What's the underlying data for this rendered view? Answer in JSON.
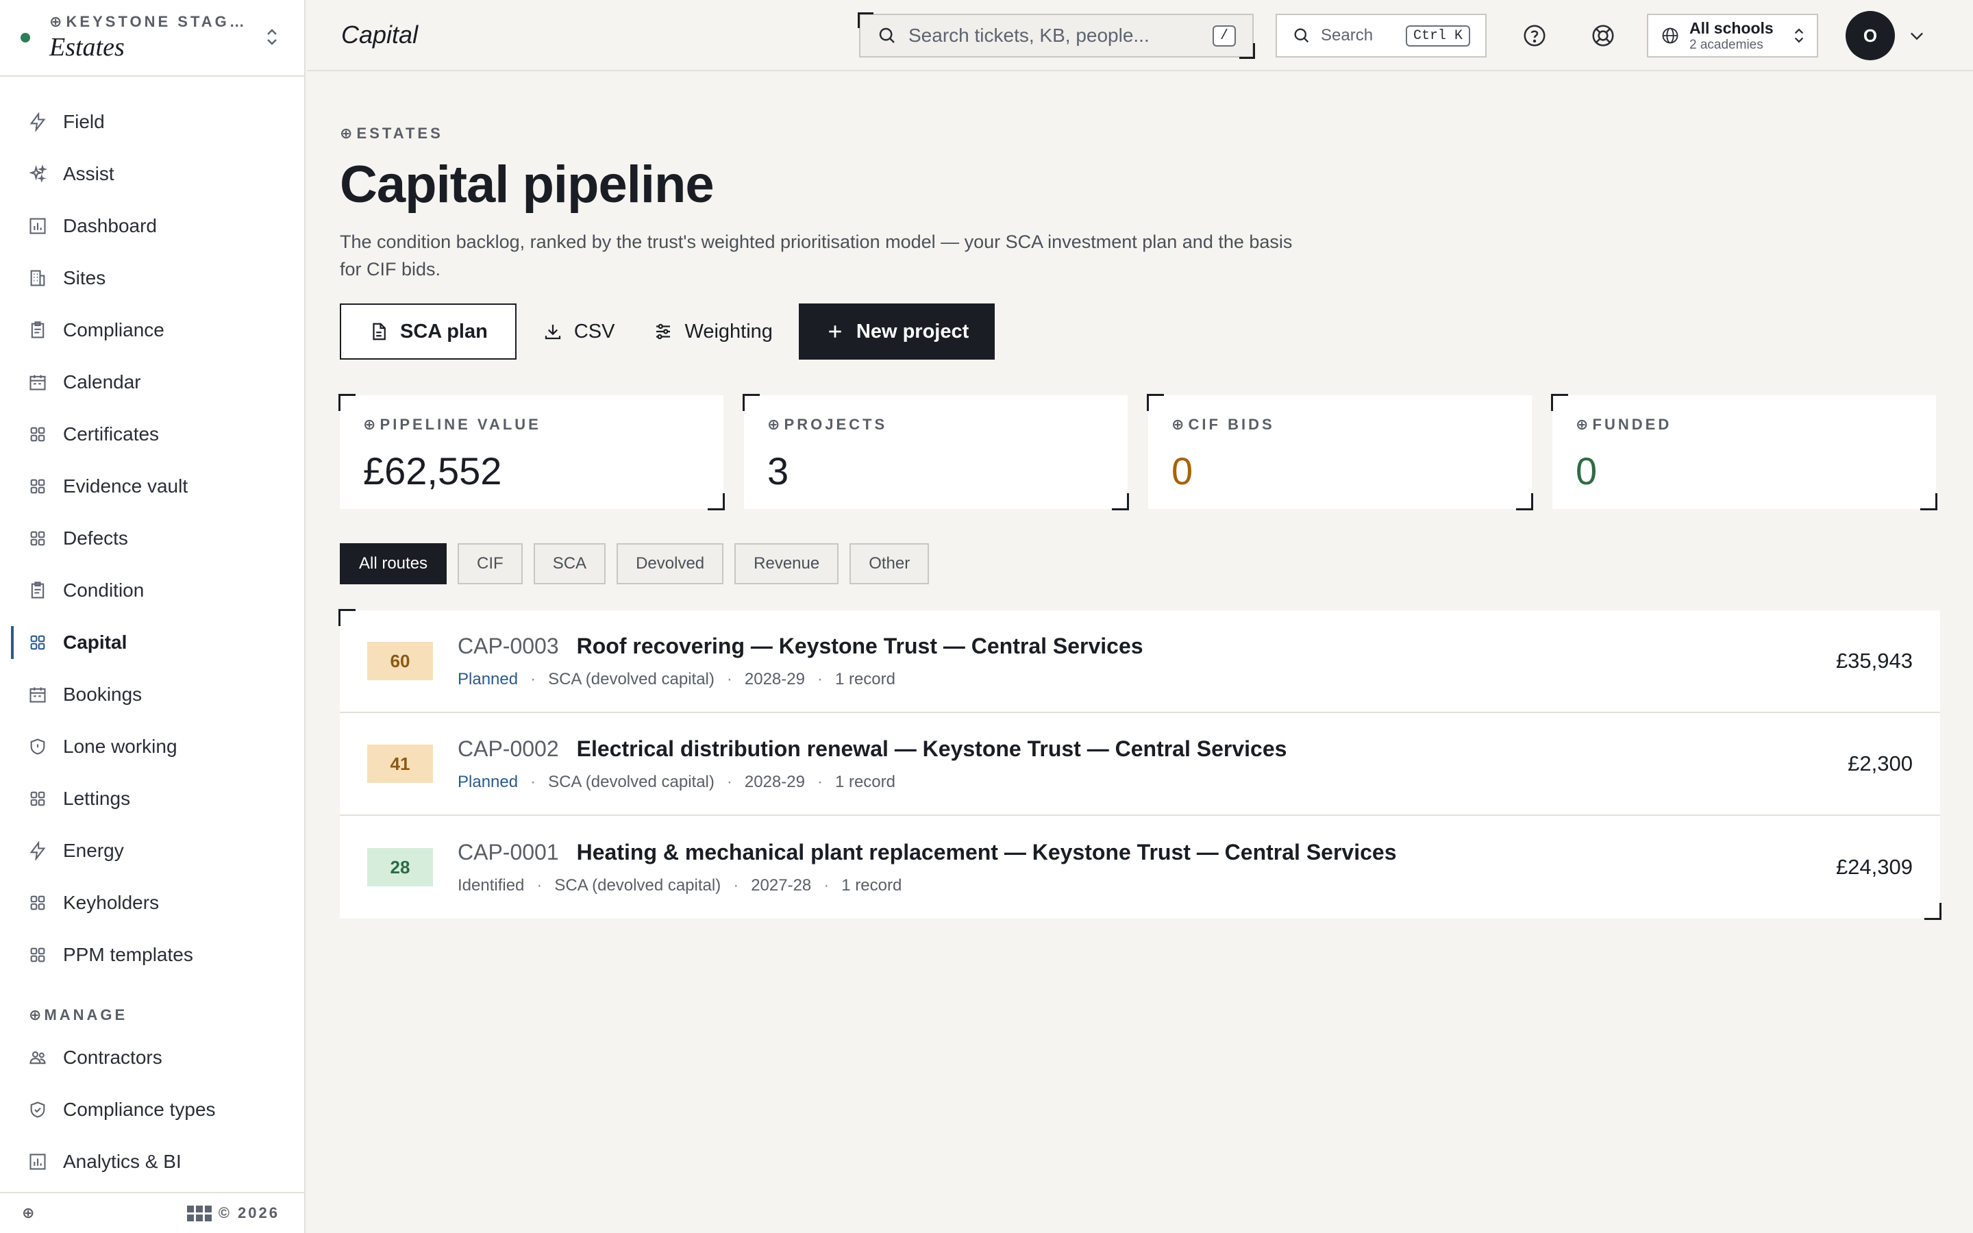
{
  "org": {
    "kicker": "KEYSTONE STAG…",
    "name": "Estates"
  },
  "sidebar": {
    "items": [
      {
        "label": "Field",
        "icon": "bolt-icon"
      },
      {
        "label": "Assist",
        "icon": "sparkle-icon"
      },
      {
        "label": "Dashboard",
        "icon": "chart-icon"
      },
      {
        "label": "Sites",
        "icon": "building-icon"
      },
      {
        "label": "Compliance",
        "icon": "clipboard-icon"
      },
      {
        "label": "Calendar",
        "icon": "calendar-icon"
      },
      {
        "label": "Certificates",
        "icon": "grid-icon"
      },
      {
        "label": "Evidence vault",
        "icon": "grid-icon"
      },
      {
        "label": "Defects",
        "icon": "grid-icon"
      },
      {
        "label": "Condition",
        "icon": "clipboard-icon"
      },
      {
        "label": "Capital",
        "icon": "grid-icon",
        "active": true
      },
      {
        "label": "Bookings",
        "icon": "calendar-icon"
      },
      {
        "label": "Lone working",
        "icon": "shield-icon"
      },
      {
        "label": "Lettings",
        "icon": "grid-icon"
      },
      {
        "label": "Energy",
        "icon": "bolt-icon"
      },
      {
        "label": "Keyholders",
        "icon": "grid-icon"
      },
      {
        "label": "PPM templates",
        "icon": "grid-icon"
      }
    ],
    "manage_label": "MANAGE",
    "manage_items": [
      {
        "label": "Contractors",
        "icon": "people-icon"
      },
      {
        "label": "Compliance types",
        "icon": "shield-check-icon"
      },
      {
        "label": "Analytics & BI",
        "icon": "chart-icon"
      }
    ],
    "footer_left": "⊕",
    "footer_right": "© 2026"
  },
  "topbar": {
    "breadcrumb": "Capital",
    "search_placeholder": "Search tickets, KB, people...",
    "search_shortcut": "/",
    "cmd_search_label": "Search",
    "cmd_search_shortcut": "Ctrl K",
    "school_name": "All schools",
    "school_sub": "2 academies",
    "avatar_initial": "O"
  },
  "page": {
    "kicker": "ESTATES",
    "title": "Capital pipeline",
    "description": "The condition backlog, ranked by the trust's weighted prioritisation model — your SCA investment plan and the basis for CIF bids.",
    "actions": {
      "sca_plan": "SCA plan",
      "csv": "CSV",
      "weighting": "Weighting",
      "new_project": "New project"
    }
  },
  "stats": [
    {
      "label": "PIPELINE VALUE",
      "value": "£62,552",
      "color": "#1a1d24"
    },
    {
      "label": "PROJECTS",
      "value": "3",
      "color": "#1a1d24"
    },
    {
      "label": "CIF BIDS",
      "value": "0",
      "color": "#a8620c"
    },
    {
      "label": "FUNDED",
      "value": "0",
      "color": "#2e6b45"
    }
  ],
  "filters": [
    "All routes",
    "CIF",
    "SCA",
    "Devolved",
    "Revenue",
    "Other"
  ],
  "projects": [
    {
      "score": "60",
      "ref": "CAP-0003",
      "title": "Roof recovering — Keystone Trust — Central Services",
      "status": "Planned",
      "route": "SCA (devolved capital)",
      "year": "2028-29",
      "records": "1 record",
      "amount": "£35,943"
    },
    {
      "score": "41",
      "ref": "CAP-0002",
      "title": "Electrical distribution renewal — Keystone Trust — Central Services",
      "status": "Planned",
      "route": "SCA (devolved capital)",
      "year": "2028-29",
      "records": "1 record",
      "amount": "£2,300"
    },
    {
      "score": "28",
      "ref": "CAP-0001",
      "title": "Heating & mechanical plant replacement — Keystone Trust — Central Services",
      "status": "Identified",
      "route": "SCA (devolved capital)",
      "year": "2027-28",
      "records": "1 record",
      "amount": "£24,309"
    }
  ]
}
